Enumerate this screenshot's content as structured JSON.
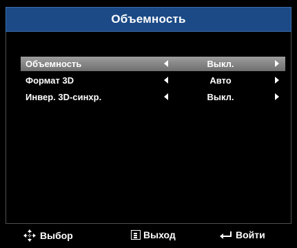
{
  "title": "Объемность",
  "menu": {
    "items": [
      {
        "label": "Объемность",
        "value": "Выкл.",
        "selected": true
      },
      {
        "label": "Формат 3D",
        "value": "Авто",
        "selected": false
      },
      {
        "label": "Инвер. 3D-синхр.",
        "value": "Выкл.",
        "selected": false
      }
    ]
  },
  "footer": {
    "select_label": "Выбор",
    "select_icon": "four-way-arrows-icon",
    "exit_label": "Выход",
    "exit_icon": "menu-box-icon",
    "enter_label": "Войти",
    "enter_icon": "enter-arrow-icon"
  },
  "colors": {
    "background": "#000000",
    "title_bar": "#1b4a86",
    "selected_row": "#8a8a8a",
    "text": "#ffffff"
  }
}
